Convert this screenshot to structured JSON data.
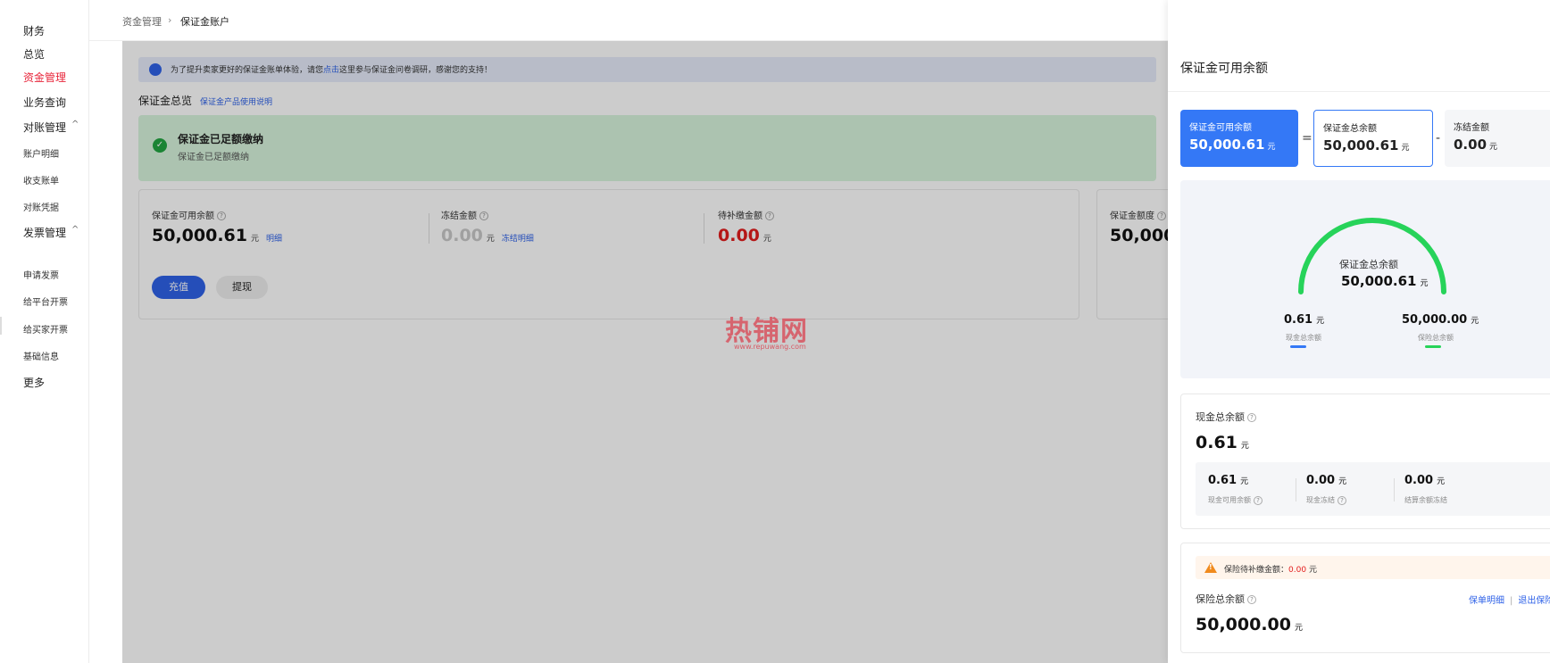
{
  "sidebar": {
    "items": [
      {
        "label": "财务"
      },
      {
        "label": "总览"
      },
      {
        "label": "资金管理"
      },
      {
        "label": "业务查询"
      },
      {
        "label": "对账管理"
      },
      {
        "label": "账户明细"
      },
      {
        "label": "收支账单"
      },
      {
        "label": "对账凭据"
      },
      {
        "label": "发票管理"
      },
      {
        "label": "申请发票"
      },
      {
        "label": "给平台开票"
      },
      {
        "label": "给买家开票"
      },
      {
        "label": "基础信息"
      },
      {
        "label": "更多"
      }
    ],
    "chevron": "^"
  },
  "breadcrumb": {
    "parent": "资金管理",
    "separator": "›",
    "current": "保证金账户"
  },
  "notice": {
    "text_before": "为了提升卖家更好的保证金账单体验，请您",
    "link": "点击",
    "text_after": "这里参与保证金问卷调研，感谢您的支持！"
  },
  "overview": {
    "title": "保证金总览",
    "link": "保证金产品使用说明"
  },
  "success": {
    "title": "保证金已足额缴纳",
    "subtitle": "保证金已足额缴纳",
    "icon": "check-icon"
  },
  "metrics": [
    {
      "label": "保证金可用余额",
      "value": "50,000.61",
      "unit": "元",
      "link": "明细"
    },
    {
      "label": "冻结金额",
      "value": "0.00",
      "unit": "元",
      "link": "冻结明细"
    },
    {
      "label": "待补缴金额",
      "value": "0.00",
      "unit": "元"
    }
  ],
  "quota": {
    "label": "保证金额度",
    "value": "50,000"
  },
  "buttons": {
    "recharge": "充值",
    "withdraw": "提现"
  },
  "watermark": {
    "main": "热铺网",
    "sub": "www.repuwang.com"
  },
  "drawer": {
    "title": "保证金可用余额",
    "equation": {
      "available": {
        "label": "保证金可用余额",
        "value": "50,000.61",
        "unit": "元"
      },
      "op1": "=",
      "total": {
        "label": "保证金总余额",
        "value": "50,000.61",
        "unit": "元"
      },
      "op2": "-",
      "frozen": {
        "label": "冻结金额",
        "value": "0.00",
        "unit": "元"
      }
    },
    "gauge": {
      "center_label": "保证金总余额",
      "center_value": "50,000.61",
      "unit": "元",
      "cash": {
        "value": "0.61",
        "caption": "现金总余额",
        "color": "#3478f6"
      },
      "insurance": {
        "value": "50,000.00",
        "caption": "保险总余额",
        "color": "#27d35a"
      }
    },
    "cash": {
      "label": "现金总余额",
      "value": "0.61",
      "unit": "元",
      "items": [
        {
          "value": "0.61",
          "unit": "元",
          "caption": "现金可用余额"
        },
        {
          "value": "0.00",
          "unit": "元",
          "caption": "现金冻结"
        },
        {
          "value": "0.00",
          "unit": "元",
          "caption": "结算余额冻结"
        }
      ]
    },
    "insurance": {
      "warning_label": "保险待补缴金额：",
      "warning_value": "0.00",
      "warning_unit": "元",
      "label": "保险总余额",
      "link_policy": "保单明细",
      "link_sep": "|",
      "link_exit": "退出保险",
      "value": "50,000.00",
      "unit": "元"
    }
  },
  "colors": {
    "primary": "#2f62e8",
    "accent_red": "#e31d1d",
    "success_green": "#22a641",
    "gauge_green": "#27d35a"
  }
}
